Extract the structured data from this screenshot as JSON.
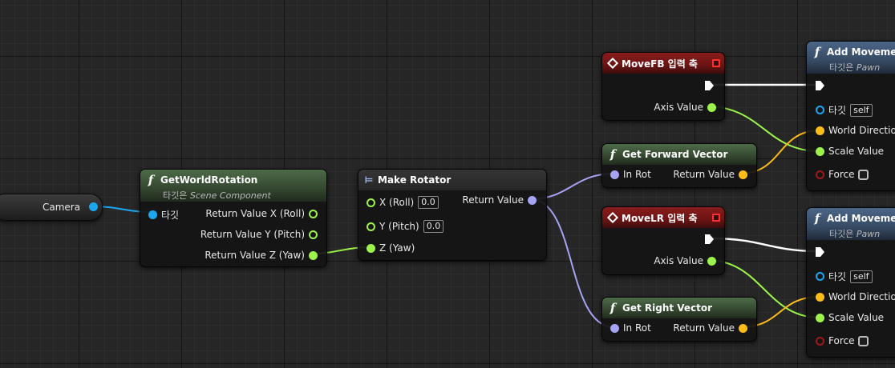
{
  "variable": {
    "label": "Camera"
  },
  "get_world_rotation": {
    "title": "GetWorldRotation",
    "target_prefix": "타깃은",
    "target_class": "Scene Component",
    "input_target": "타깃",
    "out_x": "Return Value X (Roll)",
    "out_y": "Return Value Y (Pitch)",
    "out_z": "Return Value Z (Yaw)"
  },
  "make_rotator": {
    "title": "Make Rotator",
    "x_label": "X (Roll)",
    "x_value": "0.0",
    "y_label": "Y (Pitch)",
    "y_value": "0.0",
    "z_label": "Z (Yaw)",
    "return_label": "Return Value"
  },
  "move_fb": {
    "title": "MoveFB 입력 축",
    "axis_label": "Axis Value"
  },
  "get_forward_vector": {
    "title": "Get Forward Vector",
    "in_label": "In Rot",
    "return_label": "Return Value"
  },
  "move_lr": {
    "title": "MoveLR 입력 축",
    "axis_label": "Axis Value"
  },
  "get_right_vector": {
    "title": "Get Right Vector",
    "in_label": "In Rot",
    "return_label": "Return Value"
  },
  "add_movement_1": {
    "title": "Add Movemen",
    "target_prefix": "타깃은",
    "target_class": "Pawn",
    "target_label": "타깃",
    "target_value": "self",
    "world_direction": "World Direction",
    "scale_value": "Scale Value",
    "force": "Force"
  },
  "add_movement_2": {
    "title": "Add Movemen",
    "target_prefix": "타깃은",
    "target_class": "Pawn",
    "target_label": "타깃",
    "target_value": "self",
    "world_direction": "World Direction",
    "scale_value": "Scale Value",
    "force": "Force"
  },
  "colors": {
    "float_pin": "#9cf44a",
    "rotator_pin": "#a6a3f3",
    "object_pin": "#1ba6f0",
    "vector_pin": "#fbbd16",
    "exec_pin": "#ffffff",
    "event_header": "#8a1c1c",
    "pure_function_header": "#4d6b48",
    "function_header": "#4b6688"
  }
}
